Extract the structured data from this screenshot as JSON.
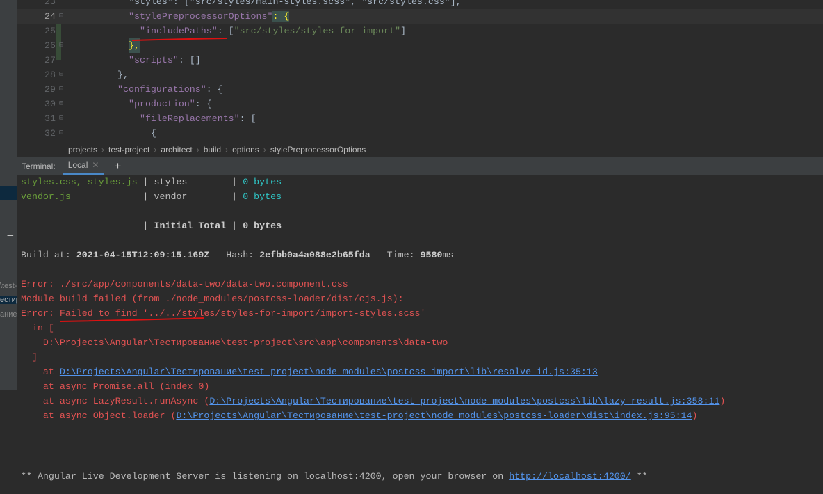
{
  "sidebar": {
    "fragments": [
      "\\test-",
      "естир",
      "ание"
    ]
  },
  "editor": {
    "lines": [
      {
        "num": "23",
        "text": "\"styles\": [\"src/styles/main-styles.scss\", \"src/styles.css\"],"
      },
      {
        "num": "24",
        "key": "\"stylePreprocessorOptions\"",
        "rest": ": {"
      },
      {
        "num": "25",
        "key": "\"includePaths\"",
        "colon": ": [",
        "val": "\"src/styles/styles-for-import\"",
        "end": "]"
      },
      {
        "num": "26",
        "text": "},"
      },
      {
        "num": "27",
        "key": "\"scripts\"",
        "rest": ": []"
      },
      {
        "num": "28",
        "text": "},"
      },
      {
        "num": "29",
        "key": "\"configurations\"",
        "rest": ": {"
      },
      {
        "num": "30",
        "key": "\"production\"",
        "rest": ": {"
      },
      {
        "num": "31",
        "key": "\"fileReplacements\"",
        "rest": ": ["
      },
      {
        "num": "32",
        "text": "{"
      }
    ]
  },
  "breadcrumbs": [
    "projects",
    "test-project",
    "architect",
    "build",
    "options",
    "stylePreprocessorOptions"
  ],
  "terminal": {
    "label": "Terminal:",
    "tab": "Local",
    "new_tab": "+",
    "rows": [
      {
        "files": "styles.css, styles.js",
        "name": "styles       ",
        "size": "0 bytes"
      },
      {
        "files": "vendor.js            ",
        "name": "vendor       ",
        "size": "0 bytes"
      }
    ],
    "total_label": "Initial Total",
    "total_size": "0 bytes",
    "build": {
      "prefix": "Build at: ",
      "date": "2021-04-15T12:09:15.169Z",
      "hash_label": " - Hash: ",
      "hash": "2efbb0a4a088e2b65fda",
      "time_label": " - Time: ",
      "time": "9580",
      "ms": "ms"
    },
    "errors": [
      "Error: ./src/app/components/data-two/data-two.component.css",
      "Module build failed (from ./node_modules/postcss-loader/dist/cjs.js):",
      "Error: Failed to find '../../styles/styles-for-import/import-styles.scss'",
      "  in [",
      "    D:\\Projects\\Angular\\Тестирование\\test-project\\src\\app\\components\\data-two",
      "  ]"
    ],
    "stack": [
      {
        "pre": "    at ",
        "link": "D:\\Projects\\Angular\\Тестирование\\test-project\\node_modules\\postcss-import\\lib\\resolve-id.js:35:13",
        "post": ""
      },
      {
        "pre": "    at async Promise.all (index 0)",
        "link": "",
        "post": ""
      },
      {
        "pre": "    at async LazyResult.runAsync (",
        "link": "D:\\Projects\\Angular\\Тестирование\\test-project\\node_modules\\postcss\\lib\\lazy-result.js:358:11",
        "post": ")"
      },
      {
        "pre": "    at async Object.loader (",
        "link": "D:\\Projects\\Angular\\Тестирование\\test-project\\node_modules\\postcss-loader\\dist\\index.js:95:14",
        "post": ")"
      }
    ],
    "server": {
      "pre": "** Angular Live Development Server is listening on localhost:4200, open your browser on ",
      "link": "http://localhost:4200/",
      "post": " **"
    }
  }
}
